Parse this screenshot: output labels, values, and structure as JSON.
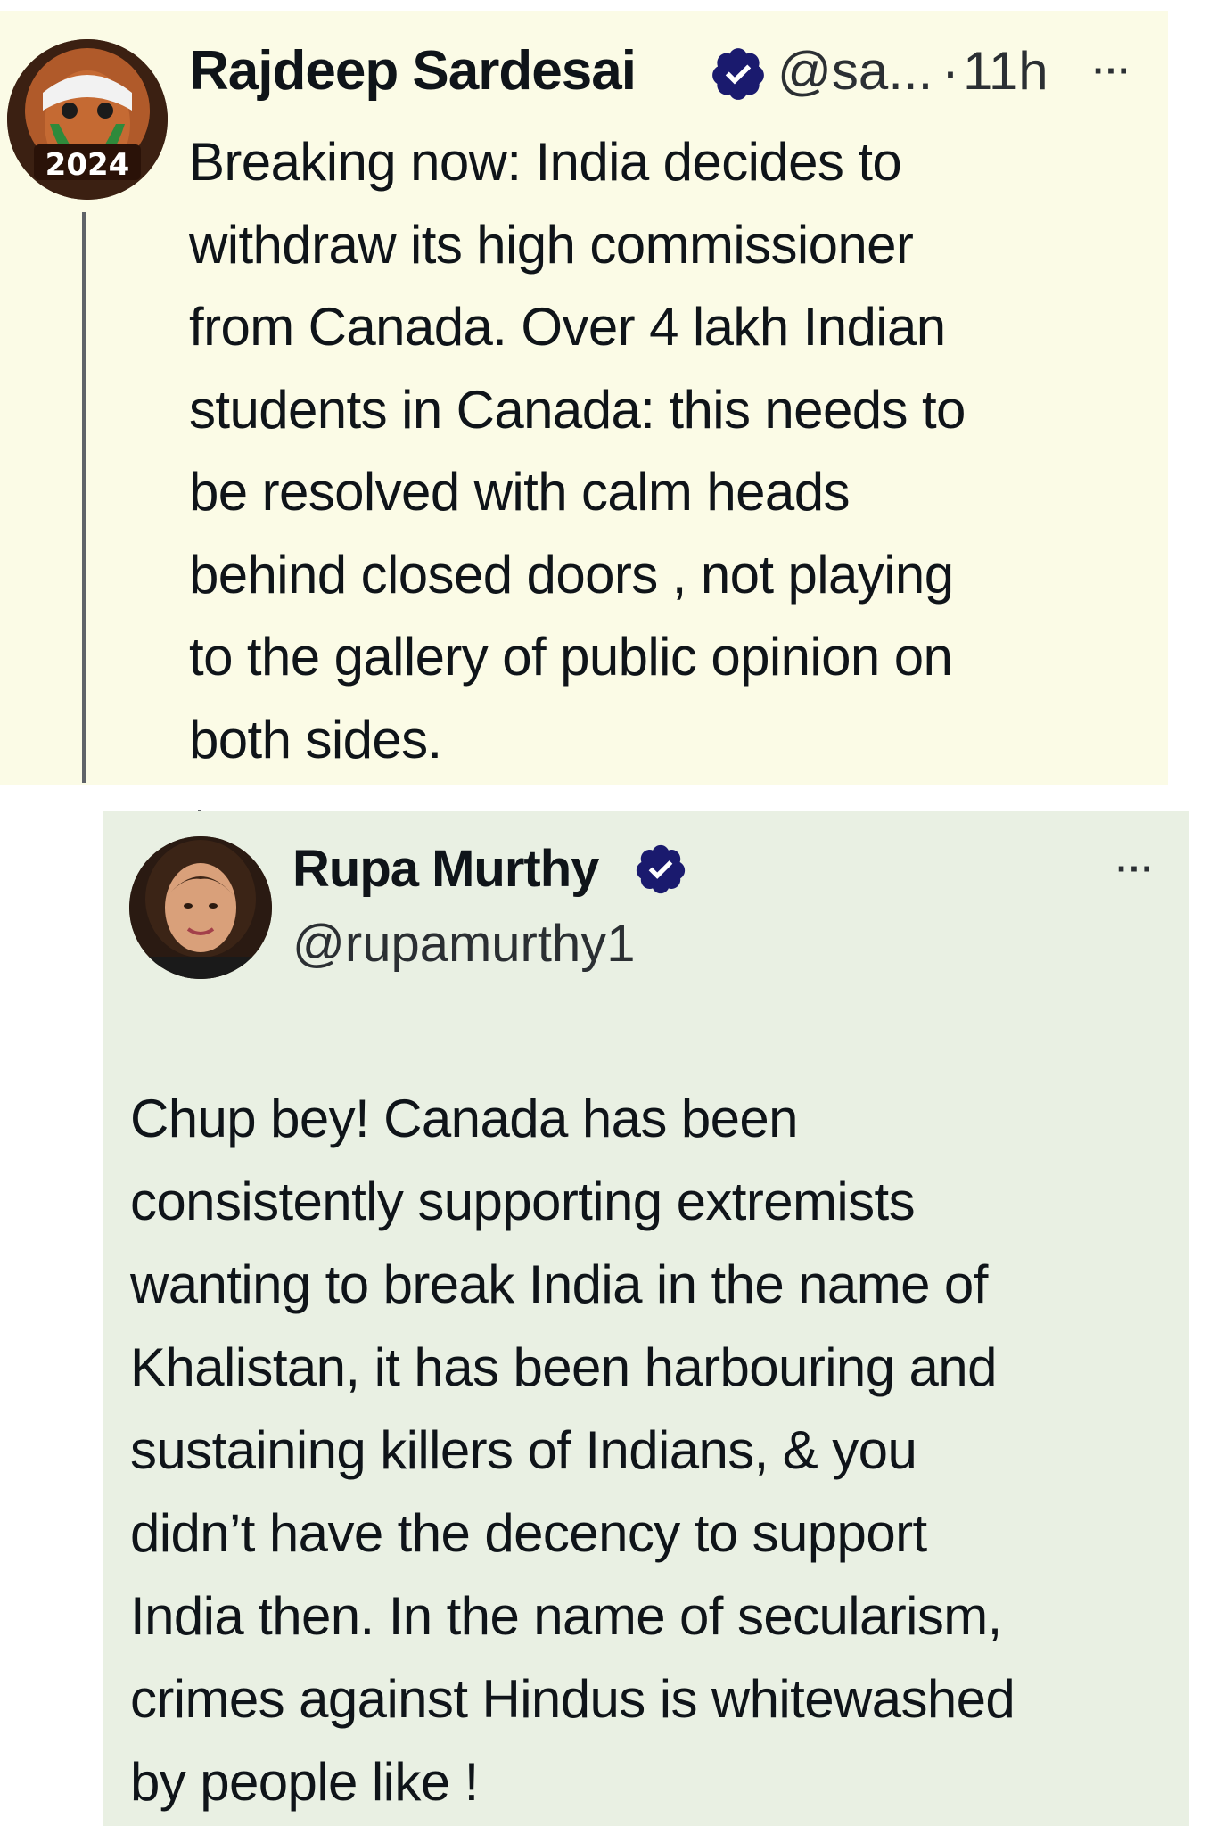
{
  "tweet1": {
    "avatar_badge": "2024",
    "author_name": "Rajdeep Sardesai",
    "handle": "@sa...",
    "separator": "·",
    "time": "11h",
    "more": "···",
    "body_lines": [
      "Breaking now: India decides to",
      "withdraw its high commissioner",
      "from Canada. Over 4 lakh Indian",
      "students in Canada: this needs to",
      "be resolved with calm heads",
      "behind closed doors , not playing",
      "to the gallery of public opinion on",
      "both sides."
    ]
  },
  "tweet2": {
    "author_name": "Rupa Murthy",
    "handle": "@rupamurthy1",
    "more": "···",
    "body_lines": [
      "Chup bey! Canada has been",
      "consistently supporting extremists",
      "wanting to break India in the name of",
      "Khalistan, it has been harbouring and",
      "sustaining killers of Indians, & you",
      "didn’t have the decency to support",
      "India then. In the name of secularism,",
      "crimes against Hindus is whitewashed",
      "by people like !"
    ]
  },
  "colors": {
    "tweet1_bg": "#fbfbe6",
    "tweet2_bg": "#e9f0e3",
    "verified_badge": "#1a1a6e",
    "text": "#0f1419"
  },
  "icons": {
    "verified": "verified-badge-icon",
    "more": "more-options-icon"
  }
}
